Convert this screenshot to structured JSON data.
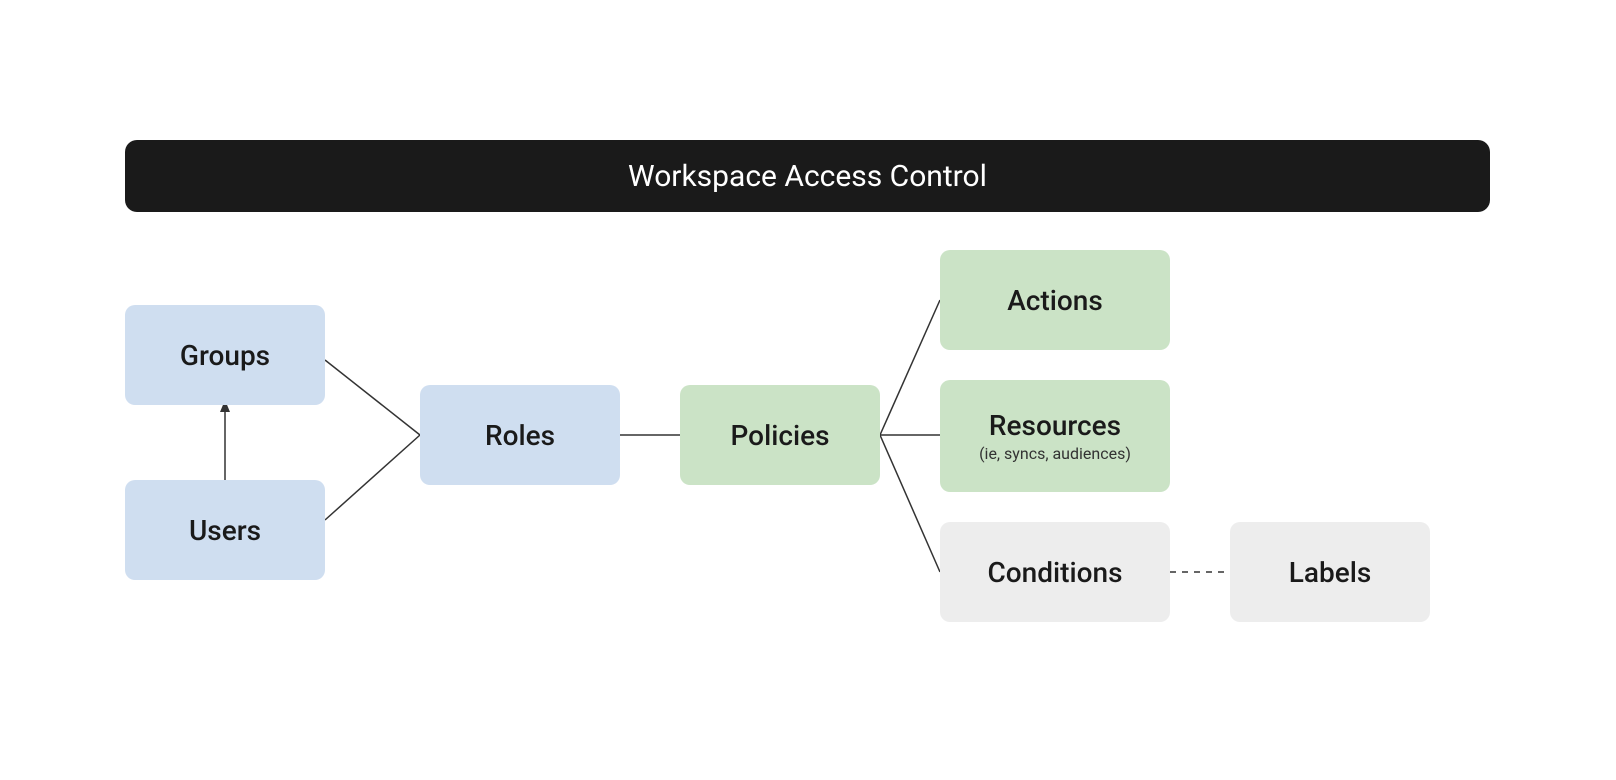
{
  "title": "Workspace Access Control",
  "nodes": {
    "groups": {
      "label": "Groups"
    },
    "users": {
      "label": "Users"
    },
    "roles": {
      "label": "Roles"
    },
    "policies": {
      "label": "Policies"
    },
    "actions": {
      "label": "Actions"
    },
    "resources": {
      "label": "Resources",
      "sublabel": "(ie, syncs, audiences)"
    },
    "conditions": {
      "label": "Conditions"
    },
    "labels": {
      "label": "Labels"
    }
  },
  "colors": {
    "blue": "#cfdef0",
    "green": "#cbe3c6",
    "grey": "#ededed",
    "titleBg": "#1a1a1a",
    "titleText": "#ffffff"
  }
}
